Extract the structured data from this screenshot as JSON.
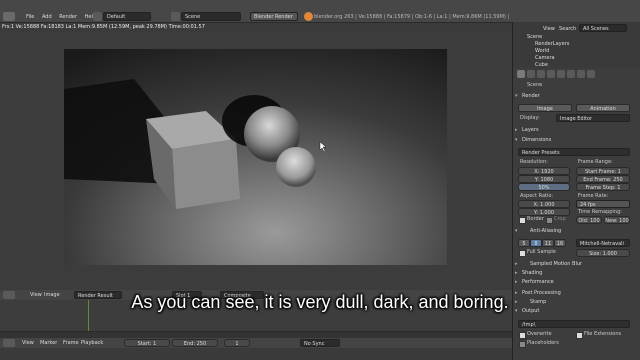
{
  "top_bar": {
    "menu": [
      "File",
      "Add",
      "Render",
      "Help"
    ],
    "layout": "Default",
    "scene": "Scene",
    "engine": "Blender Render",
    "info": "blender.org 263 | Ve:15888 | Fa:15879 | Ob:1-6 | La:1 | Mem:9.86M (11.59M) | Cube"
  },
  "render_window": {
    "status": "Frs:1  Ve:15888 Fa:18183 La:1 Mem:9.85M (12.59M, peak 29.78M) Time:00:01.57"
  },
  "image_editor_header": {
    "items": [
      "View",
      "Image"
    ],
    "slot": "Render Result",
    "layer": "Slot 1",
    "pass": "Composite"
  },
  "timeline_header": {
    "items": [
      "View",
      "Marker",
      "Frame",
      "Playback"
    ],
    "start": "Start: 1",
    "end": "End: 250",
    "current": "1",
    "sync": "No Sync"
  },
  "outliner": {
    "menu": [
      "View",
      "Search"
    ],
    "filter": "All Scenes",
    "items": [
      "Scene",
      "RenderLayers",
      "World",
      "Camera",
      "Cube"
    ]
  },
  "properties": {
    "scene_label": "Scene",
    "render_panel": "Render",
    "image_btn": "Image",
    "animation_btn": "Animation",
    "display_label": "Display:",
    "display_value": "Image Editor",
    "layers": "Layers",
    "dimensions": "Dimensions",
    "presets": "Render Presets",
    "resolution": "Resolution:",
    "res_x": "X: 1920",
    "res_y": "Y: 1080",
    "res_pct": "50%",
    "frame_range": "Frame Range:",
    "start_frame": "Start Frame: 1",
    "end_frame": "End Frame: 250",
    "frame_step": "Frame Step: 1",
    "aspect": "Aspect Ratio:",
    "asp_x": "X: 1.000",
    "asp_y": "Y: 1.000",
    "frame_rate": "Frame Rate:",
    "fps": "24 fps",
    "time_remap": "Time Remapping:",
    "old": "Old: 100",
    "new": "New: 100",
    "border": "Border",
    "crop": "Crop",
    "aa": "Anti-Aliasing",
    "aa_samples": [
      "5",
      "8",
      "11",
      "16"
    ],
    "aa_filter": "Mitchell-Netravali",
    "full_sample": "Full Sample",
    "size": "Size: 1.000",
    "motion_blur": "Sampled Motion Blur",
    "shading": "Shading",
    "performance": "Performance",
    "post_processing": "Post Processing",
    "stamp": "Stamp",
    "output": "Output",
    "path": "/tmp\\",
    "overwrite": "Overwrite",
    "file_ext": "File Extensions",
    "placeholders": "Placeholders"
  },
  "subtitle": "As you can see, it is very dull, dark, and boring."
}
